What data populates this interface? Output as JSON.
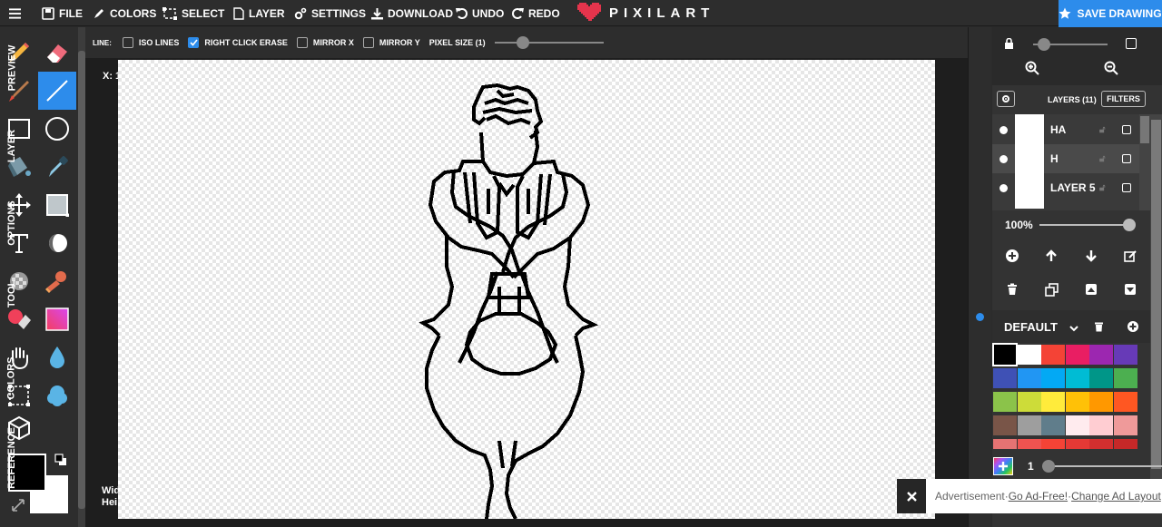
{
  "menu": {
    "file": "FILE",
    "colors": "COLORS",
    "select": "SELECT",
    "layer": "LAYER",
    "settings": "SETTINGS",
    "download": "DOWNLOAD",
    "undo": "UNDO",
    "redo": "REDO"
  },
  "brand": {
    "name": "PIXILART",
    "color": "#e5344c"
  },
  "save_drawing": "SAVE DRAWING",
  "accent_color": "#2d8ceb",
  "tools": [
    "pencil-icon",
    "eraser-icon",
    "brush-icon",
    "line-icon",
    "rectangle-icon",
    "ellipse-icon",
    "fill-bucket-icon",
    "eyedropper-icon",
    "move-icon",
    "dither-icon",
    "text-icon",
    "shade-icon",
    "pattern-icon",
    "stamp-icon",
    "color-replace-icon",
    "gradient-icon",
    "hand-icon",
    "blur-icon",
    "select-icon",
    "cloud-icon",
    "3d-cube-icon"
  ],
  "active_tool": "line-icon",
  "options": {
    "line_label": "LINE:",
    "iso_lines": "ISO LINES",
    "iso_lines_checked": false,
    "right_click_erase": "RIGHT CLICK ERASE",
    "right_click_erase_checked": true,
    "mirror_x": "MIRROR X",
    "mirror_x_checked": false,
    "mirror_y": "MIRROR Y",
    "mirror_y_checked": false,
    "pixel_size": "PIXEL SIZE (1)"
  },
  "coords": {
    "x": "X: 1",
    "width": "Wid",
    "height": "Hei"
  },
  "side_tabs": [
    "PREVIEW",
    "LAYER",
    "OPTIONS",
    "TOOL",
    "COLORS",
    "REFERENCE"
  ],
  "layers": {
    "header": "LAYERS (11)",
    "filters": "FILTERS",
    "items": [
      {
        "name": "HA"
      },
      {
        "name": "H"
      },
      {
        "name": "LAYER 5"
      }
    ],
    "opacity": "100%",
    "opacity_value": 1.0
  },
  "palette": {
    "name": "DEFAULT",
    "colors": [
      "#000000",
      "#ffffff",
      "#f44336",
      "#e91e63",
      "#9c27b0",
      "#673ab7",
      "#3f51b5",
      "#2196f3",
      "#03a9f4",
      "#00bcd4",
      "#009688",
      "#4caf50",
      "#8bc34a",
      "#cddc39",
      "#ffeb3b",
      "#ffc107",
      "#ff9800",
      "#ff5722",
      "#795548",
      "#9e9e9e",
      "#607d8b",
      "#ffebee",
      "#ffcdd2",
      "#ef9a9a",
      "#e57373",
      "#ef5350",
      "#f44336",
      "#e53935",
      "#d32f2f",
      "#c62828"
    ]
  },
  "brush_size": "1",
  "primary_color": "#000000",
  "secondary_color": "#ffffff",
  "ad": {
    "label": "Advertisement",
    "sep": " · ",
    "go_ad_free": "Go Ad-Free!",
    "change_layout": "Change Ad Layout"
  }
}
